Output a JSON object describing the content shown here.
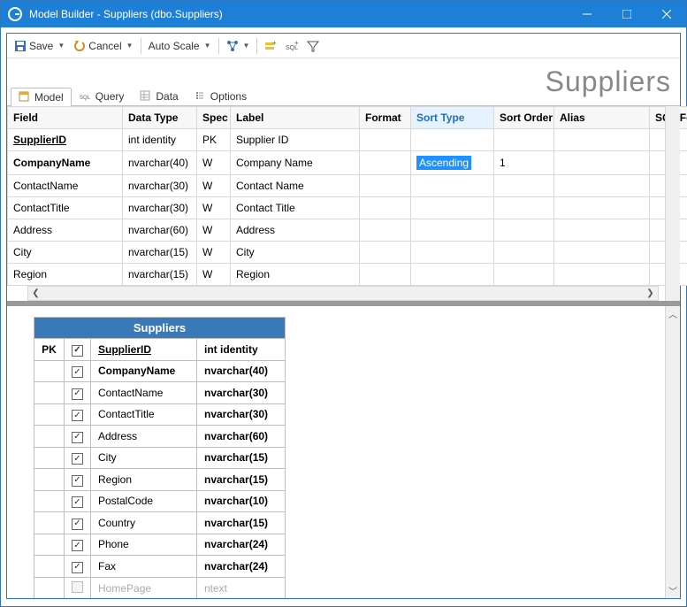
{
  "window": {
    "title": "Model Builder - Suppliers (dbo.Suppliers)"
  },
  "page_heading": "Suppliers",
  "toolbar": {
    "save": "Save",
    "cancel": "Cancel",
    "autoscale": "Auto Scale"
  },
  "tabs": [
    {
      "label": "Model",
      "icon": "model-icon",
      "active": true
    },
    {
      "label": "Query",
      "icon": "sql-icon",
      "active": false
    },
    {
      "label": "Data",
      "icon": "data-icon",
      "active": false
    },
    {
      "label": "Options",
      "icon": "options-icon",
      "active": false
    }
  ],
  "grid": {
    "columns": [
      "Field",
      "Data Type",
      "Spec",
      "Label",
      "Format",
      "Sort Type",
      "Sort Order",
      "Alias",
      "SQL Formu"
    ],
    "active_col": "Sort Type",
    "rows": [
      {
        "field": "SupplierID",
        "pk": true,
        "datatype": "int identity",
        "spec": "PK",
        "label": "Supplier ID",
        "format": "",
        "sorttype": "",
        "sortorder": "",
        "alias": "",
        "sqlf": ""
      },
      {
        "field": "CompanyName",
        "bold": true,
        "datatype": "nvarchar(40)",
        "spec": "W",
        "label": "Company Name",
        "format": "",
        "sorttype": "Ascending",
        "sortorder": "1",
        "alias": "",
        "sqlf": "",
        "selected": true
      },
      {
        "field": "ContactName",
        "datatype": "nvarchar(30)",
        "spec": "W",
        "label": "Contact Name",
        "format": "",
        "sorttype": "",
        "sortorder": "",
        "alias": "",
        "sqlf": ""
      },
      {
        "field": "ContactTitle",
        "datatype": "nvarchar(30)",
        "spec": "W",
        "label": "Contact Title",
        "format": "",
        "sorttype": "",
        "sortorder": "",
        "alias": "",
        "sqlf": ""
      },
      {
        "field": "Address",
        "datatype": "nvarchar(60)",
        "spec": "W",
        "label": "Address",
        "format": "",
        "sorttype": "",
        "sortorder": "",
        "alias": "",
        "sqlf": ""
      },
      {
        "field": "City",
        "datatype": "nvarchar(15)",
        "spec": "W",
        "label": "City",
        "format": "",
        "sorttype": "",
        "sortorder": "",
        "alias": "",
        "sqlf": ""
      },
      {
        "field": "Region",
        "datatype": "nvarchar(15)",
        "spec": "W",
        "label": "Region",
        "format": "",
        "sorttype": "",
        "sortorder": "",
        "alias": "",
        "sqlf": ""
      }
    ]
  },
  "entity": {
    "name": "Suppliers",
    "rows": [
      {
        "pk": "PK",
        "chk": true,
        "name": "SupplierID",
        "type": "int identity",
        "pkrow": true
      },
      {
        "pk": "",
        "chk": true,
        "name": "CompanyName",
        "type": "nvarchar(40)",
        "bold": true
      },
      {
        "pk": "",
        "chk": true,
        "name": "ContactName",
        "type": "nvarchar(30)"
      },
      {
        "pk": "",
        "chk": true,
        "name": "ContactTitle",
        "type": "nvarchar(30)"
      },
      {
        "pk": "",
        "chk": true,
        "name": "Address",
        "type": "nvarchar(60)"
      },
      {
        "pk": "",
        "chk": true,
        "name": "City",
        "type": "nvarchar(15)"
      },
      {
        "pk": "",
        "chk": true,
        "name": "Region",
        "type": "nvarchar(15)"
      },
      {
        "pk": "",
        "chk": true,
        "name": "PostalCode",
        "type": "nvarchar(10)"
      },
      {
        "pk": "",
        "chk": true,
        "name": "Country",
        "type": "nvarchar(15)"
      },
      {
        "pk": "",
        "chk": true,
        "name": "Phone",
        "type": "nvarchar(24)"
      },
      {
        "pk": "",
        "chk": true,
        "name": "Fax",
        "type": "nvarchar(24)"
      },
      {
        "pk": "",
        "chk": false,
        "name": "HomePage",
        "type": "ntext",
        "disabled": true
      }
    ]
  }
}
